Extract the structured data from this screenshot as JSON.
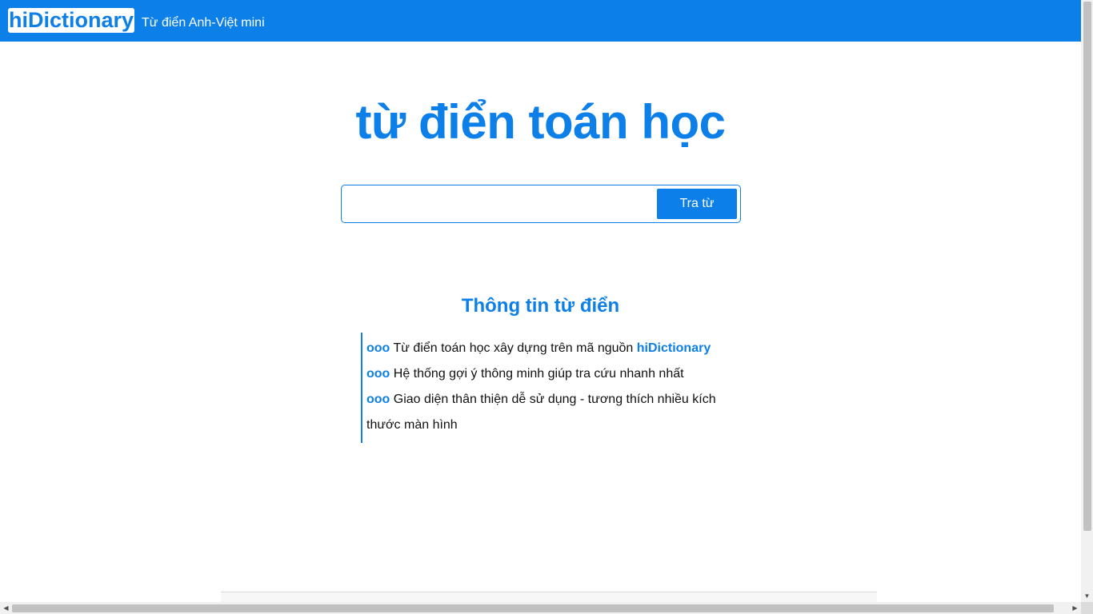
{
  "header": {
    "logo": "hiDictionary",
    "tagline": "Từ điển Anh-Việt mini"
  },
  "hero": {
    "title": "từ điển toán học"
  },
  "search": {
    "value": "",
    "placeholder": "",
    "button_label": "Tra từ"
  },
  "info": {
    "title": "Thông tin từ điển",
    "bullet": "ooo",
    "items": [
      {
        "text": "Từ điển toán học xây dựng trên mã nguồn",
        "link": "hiDictionary"
      },
      {
        "text": "Hệ thống gợi ý thông minh giúp tra cứu nhanh nhất"
      },
      {
        "text": "Giao diện thân thiện dễ sử dụng - tương thích nhiều kích thước màn hình"
      }
    ]
  },
  "colors": {
    "brand": "#0d7fe8",
    "background": "#ffffff"
  },
  "icons": {
    "scroll_up": "triangle-up-icon",
    "scroll_down": "triangle-down-icon",
    "scroll_left": "triangle-left-icon",
    "scroll_right": "triangle-right-icon"
  }
}
